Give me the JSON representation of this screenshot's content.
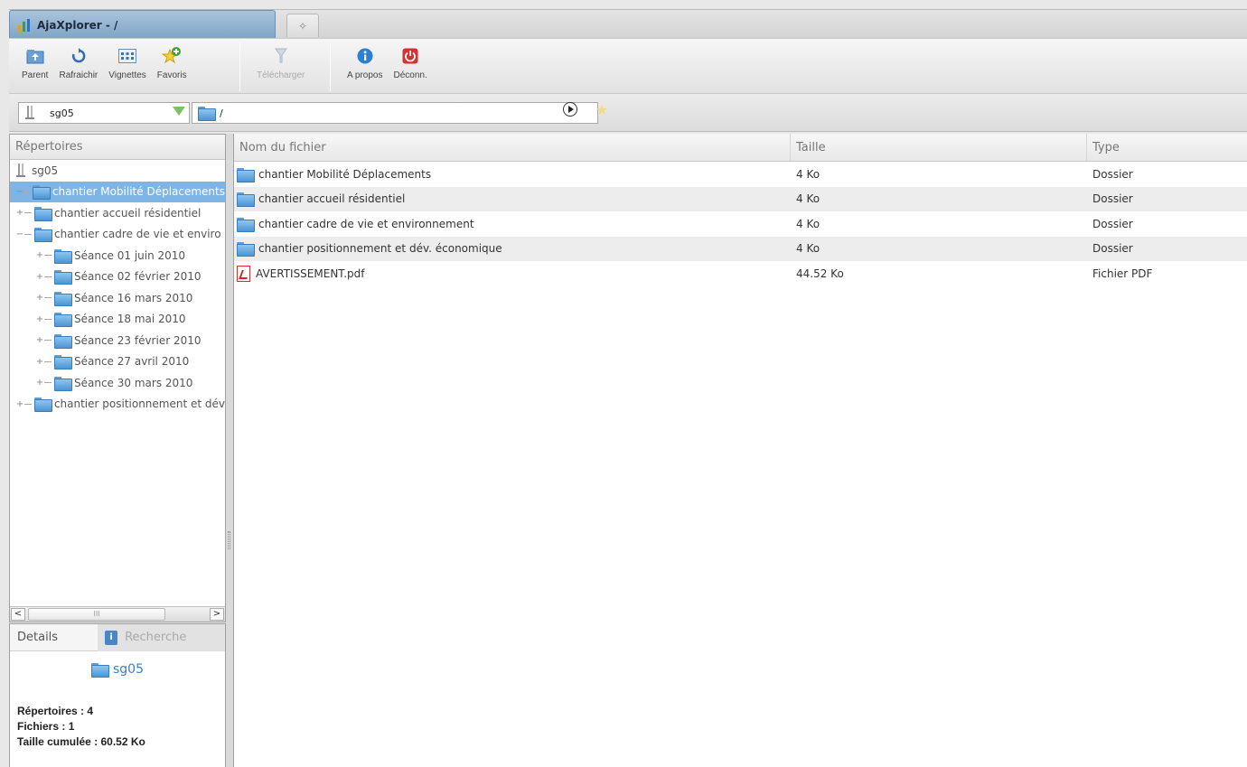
{
  "window": {
    "tab_title": "AjaXplorer - /",
    "new_tab_glyph": "✧"
  },
  "toolbar": {
    "parent": "Parent",
    "refresh": "Rafraichir",
    "thumbnails": "Vignettes",
    "favorites": "Favoris",
    "download": "Télécharger",
    "about": "A propos",
    "logout": "Déconn."
  },
  "location": {
    "repository": "sg05",
    "path": "/"
  },
  "tree": {
    "header": "Répertoires",
    "root": "sg05",
    "items": [
      {
        "label": "chantier Mobilité Déplacements",
        "level": 0,
        "expander": "−",
        "selected": true
      },
      {
        "label": "chantier accueil résidentiel",
        "level": 0,
        "expander": "+"
      },
      {
        "label": "chantier cadre de vie et enviro",
        "level": 0,
        "expander": "−"
      },
      {
        "label": "Séance 01 juin 2010",
        "level": 1,
        "expander": "+"
      },
      {
        "label": "Séance 02 février 2010",
        "level": 1,
        "expander": "+"
      },
      {
        "label": "Séance 16 mars 2010",
        "level": 1,
        "expander": "+"
      },
      {
        "label": "Séance 18 mai 2010",
        "level": 1,
        "expander": "+"
      },
      {
        "label": "Séance 23 février 2010",
        "level": 1,
        "expander": "+"
      },
      {
        "label": "Séance 27 avril 2010",
        "level": 1,
        "expander": "+"
      },
      {
        "label": "Séance 30 mars 2010",
        "level": 1,
        "expander": "+"
      },
      {
        "label": "chantier positionnement et dév",
        "level": 0,
        "expander": "+"
      }
    ]
  },
  "scrollbar": {
    "left": "<",
    "right": ">",
    "grip": "III"
  },
  "details": {
    "tab_details": "Details",
    "tab_search": "Recherche",
    "title": "sg05",
    "dirs_label": "Répertoires :",
    "dirs_value": "4",
    "files_label": "Fichiers :",
    "files_value": "1",
    "size_label": "Taille cumulée :",
    "size_value": "60.52 Ko"
  },
  "list": {
    "columns": [
      "Nom du fichier",
      "Taille",
      "Type"
    ],
    "rows": [
      {
        "name": "chantier Mobilité Déplacements",
        "size": "4 Ko",
        "type": "Dossier",
        "icon": "folder-icon"
      },
      {
        "name": "chantier accueil résidentiel",
        "size": "4 Ko",
        "type": "Dossier",
        "icon": "folder-icon"
      },
      {
        "name": "chantier cadre de vie et environnement",
        "size": "4 Ko",
        "type": "Dossier",
        "icon": "folder-icon"
      },
      {
        "name": "chantier positionnement et dév. économique",
        "size": "4 Ko",
        "type": "Dossier",
        "icon": "folder-icon"
      },
      {
        "name": "AVERTISSEMENT.pdf",
        "size": "44.52 Ko",
        "type": "Fichier PDF",
        "icon": "pdf-icon"
      }
    ]
  },
  "colors": {
    "selection": "#7fb5e4",
    "tab_active": "#8fb0cf",
    "accent_blue": "#3c7ec4"
  }
}
